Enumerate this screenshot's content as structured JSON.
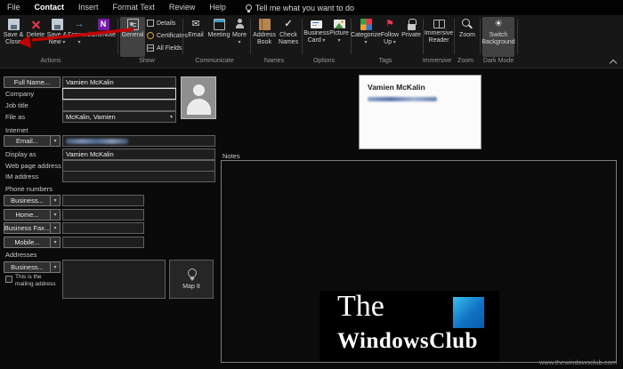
{
  "menu": {
    "items": [
      "File",
      "Contact",
      "Insert",
      "Format Text",
      "Review",
      "Help"
    ],
    "active_item": "Contact",
    "tell_me": "Tell me what you want to do"
  },
  "ribbon": {
    "buttons": {
      "save_close": "Save &\nClose",
      "delete": "Delete",
      "save_new": "Save &\nNew",
      "forward": "Forward",
      "onenote": "OneNote",
      "general": "General",
      "details": "Details",
      "certificates": "Certificates",
      "all_fields": "All Fields",
      "email": "Email",
      "meeting": "Meeting",
      "more": "More",
      "address_book": "Address\nBook",
      "check_names": "Check\nNames",
      "business_card": "Business\nCard",
      "picture": "Picture",
      "categorize": "Categorize",
      "follow_up": "Follow\nUp",
      "private": "Private",
      "immersive_reader": "Immersive\nReader",
      "zoom": "Zoom",
      "switch_background": "Switch\nBackground"
    },
    "group_labels": [
      "Actions",
      "Show",
      "Communicate",
      "Names",
      "Options",
      "Tags",
      "Immersive",
      "Zoom",
      "Dark Mode"
    ]
  },
  "form": {
    "full_name_button": "Full Name...",
    "full_name_value": "Vamien McKalin",
    "company_label": "Company",
    "company_value": "",
    "job_title_label": "Job title",
    "job_title_value": "",
    "file_as_label": "File as",
    "file_as_value": "McKalin, Vamien",
    "internet_header": "Internet",
    "email_button": "Email...",
    "email_redacted": true,
    "display_as_label": "Display as",
    "display_as_value": "Vamien McKalin",
    "web_page_label": "Web page address",
    "web_page_value": "",
    "im_label": "IM address",
    "im_value": "",
    "phone_header": "Phone numbers",
    "phone_rows": [
      {
        "button": "Business..."
      },
      {
        "button": "Home..."
      },
      {
        "button": "Business Fax..."
      },
      {
        "button": "Mobile..."
      }
    ],
    "addresses_header": "Addresses",
    "address_button": "Business...",
    "mailing_checkbox_label": "This is the mailing address",
    "mailing_checkbox_checked": false,
    "map_it_label": "Map It"
  },
  "business_card": {
    "name": "Vamien McKalin",
    "email_redacted": true
  },
  "notes": {
    "label": "Notes"
  },
  "logo": {
    "line1": "The",
    "line2": "WindowsClub"
  },
  "watermark": "www.thewindowsclub.com",
  "annotation": {
    "arrow_color": "#c00000"
  },
  "colors": {
    "page_bg": "#0a0a0a",
    "ribbon_bg": "#171717",
    "highlight_bg": "#424242",
    "logo_blue_top": "#39c1f0",
    "logo_blue_bottom": "#0a5aa8",
    "delete_red": "#e8364f"
  }
}
